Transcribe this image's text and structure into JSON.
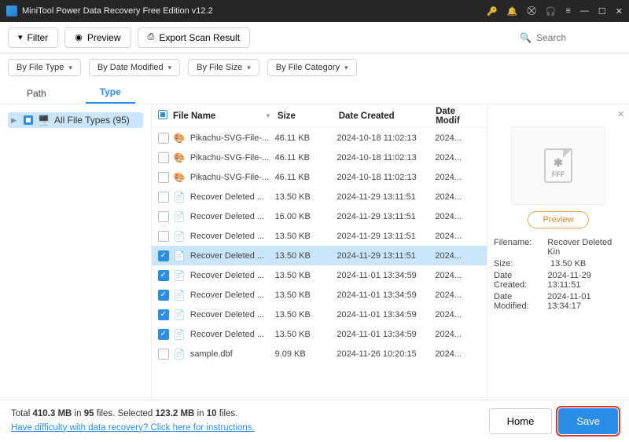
{
  "title": "MiniTool Power Data Recovery Free Edition v12.2",
  "toolbar": {
    "filter": "Filter",
    "preview": "Preview",
    "export": "Export Scan Result",
    "search_placeholder": "Search"
  },
  "filters": {
    "type": "By File Type",
    "date": "By Date Modified",
    "size": "By File Size",
    "category": "By File Category"
  },
  "tabs": {
    "path": "Path",
    "type": "Type"
  },
  "tree": {
    "root": "All File Types (95)"
  },
  "columns": {
    "name": "File Name",
    "size": "Size",
    "dc": "Date Created",
    "dm": "Date Modif"
  },
  "rows": [
    {
      "checked": false,
      "icon": "🎨",
      "name": "Pikachu-SVG-File-...",
      "size": "46.11 KB",
      "dc": "2024-10-18 11:02:13",
      "dm": "2024..."
    },
    {
      "checked": false,
      "icon": "🎨",
      "name": "Pikachu-SVG-File-...",
      "size": "46.11 KB",
      "dc": "2024-10-18 11:02:13",
      "dm": "2024..."
    },
    {
      "checked": false,
      "icon": "🎨",
      "name": "Pikachu-SVG-File-...",
      "size": "46.11 KB",
      "dc": "2024-10-18 11:02:13",
      "dm": "2024..."
    },
    {
      "checked": false,
      "icon": "📄",
      "name": "Recover Deleted ...",
      "size": "13.50 KB",
      "dc": "2024-11-29 13:11:51",
      "dm": "2024..."
    },
    {
      "checked": false,
      "icon": "📄",
      "name": "Recover Deleted ...",
      "size": "16.00 KB",
      "dc": "2024-11-29 13:11:51",
      "dm": "2024..."
    },
    {
      "checked": false,
      "icon": "📄",
      "name": "Recover Deleted ...",
      "size": "13.50 KB",
      "dc": "2024-11-29 13:11:51",
      "dm": "2024..."
    },
    {
      "checked": true,
      "sel": true,
      "icon": "📄",
      "name": "Recover Deleted ...",
      "size": "13.50 KB",
      "dc": "2024-11-29 13:11:51",
      "dm": "2024..."
    },
    {
      "checked": true,
      "icon": "📄",
      "name": "Recover Deleted ...",
      "size": "13.50 KB",
      "dc": "2024-11-01 13:34:59",
      "dm": "2024..."
    },
    {
      "checked": true,
      "icon": "📄",
      "name": "Recover Deleted ...",
      "size": "13.50 KB",
      "dc": "2024-11-01 13:34:59",
      "dm": "2024..."
    },
    {
      "checked": true,
      "icon": "📄",
      "name": "Recover Deleted ...",
      "size": "13.50 KB",
      "dc": "2024-11-01 13:34:59",
      "dm": "2024..."
    },
    {
      "checked": true,
      "icon": "📄",
      "name": "Recover Deleted ...",
      "size": "13.50 KB",
      "dc": "2024-11-01 13:34:59",
      "dm": "2024..."
    },
    {
      "checked": false,
      "icon": "📄",
      "name": "sample.dbf",
      "size": "9.09 KB",
      "dc": "2024-11-26 10:20:15",
      "dm": "2024..."
    }
  ],
  "preview": {
    "btn": "Preview",
    "filetype": "FFF",
    "meta": [
      {
        "l": "Filename:",
        "v": "Recover Deleted Kin"
      },
      {
        "l": "Size:",
        "v": "13.50 KB"
      },
      {
        "l": "Date Created:",
        "v": "2024-11-29 13:11:51"
      },
      {
        "l": "Date Modified:",
        "v": "2024-11-01 13:34:17"
      }
    ]
  },
  "footer": {
    "total_pre": "Total ",
    "total_b": "410.3 MB",
    "total_mid": " in ",
    "total_files": "95",
    "total_post": " files.",
    "sel_pre": "  Selected ",
    "sel_b": "123.2 MB",
    "sel_mid": " in ",
    "sel_files": "10",
    "sel_post": " files.",
    "help": "Have difficulty with data recovery? Click here for instructions.",
    "home": "Home",
    "save": "Save"
  }
}
